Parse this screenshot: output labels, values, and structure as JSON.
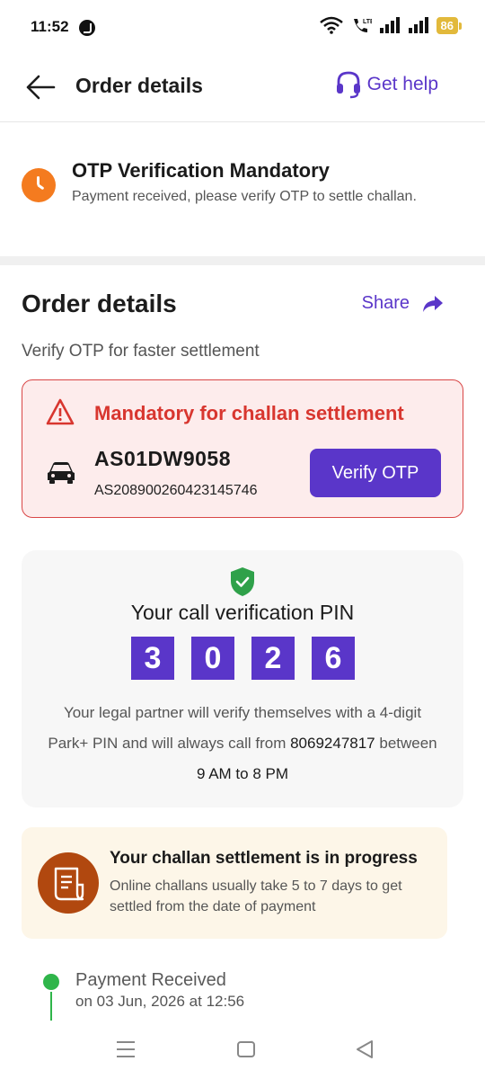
{
  "status_bar": {
    "time": "11:52",
    "battery": "86"
  },
  "app_bar": {
    "title": "Order details",
    "help_label": "Get help"
  },
  "banner": {
    "title": "OTP Verification Mandatory",
    "subtitle": "Payment received, please verify OTP to settle challan."
  },
  "order": {
    "title": "Order details",
    "share_label": "Share",
    "subtitle": "Verify OTP for faster settlement",
    "mandatory_text": "Mandatory for challan settlement",
    "vehicle_number": "AS01DW9058",
    "challan_number": "AS208900260423145746",
    "verify_button": "Verify OTP"
  },
  "pin": {
    "title": "Your call verification PIN",
    "digits": [
      "3",
      "0",
      "2",
      "6"
    ],
    "note_part1": "Your legal partner will verify themselves with a 4-digit Park+ PIN and will always call from ",
    "phone": "8069247817",
    "note_part2": " between ",
    "hours": "9 AM to 8 PM"
  },
  "settlement": {
    "title": "Your challan settlement is in progress",
    "subtitle": "Online challans usually take 5 to 7 days to get settled from the date of payment"
  },
  "timeline": [
    {
      "title": "Payment Received",
      "date": "on 03 Jun, 2026 at 12:56"
    }
  ],
  "colors": {
    "accent": "#5a36c9",
    "danger": "#d8362f",
    "success": "#2fb54a",
    "warning_bg": "#fdf6e8"
  }
}
